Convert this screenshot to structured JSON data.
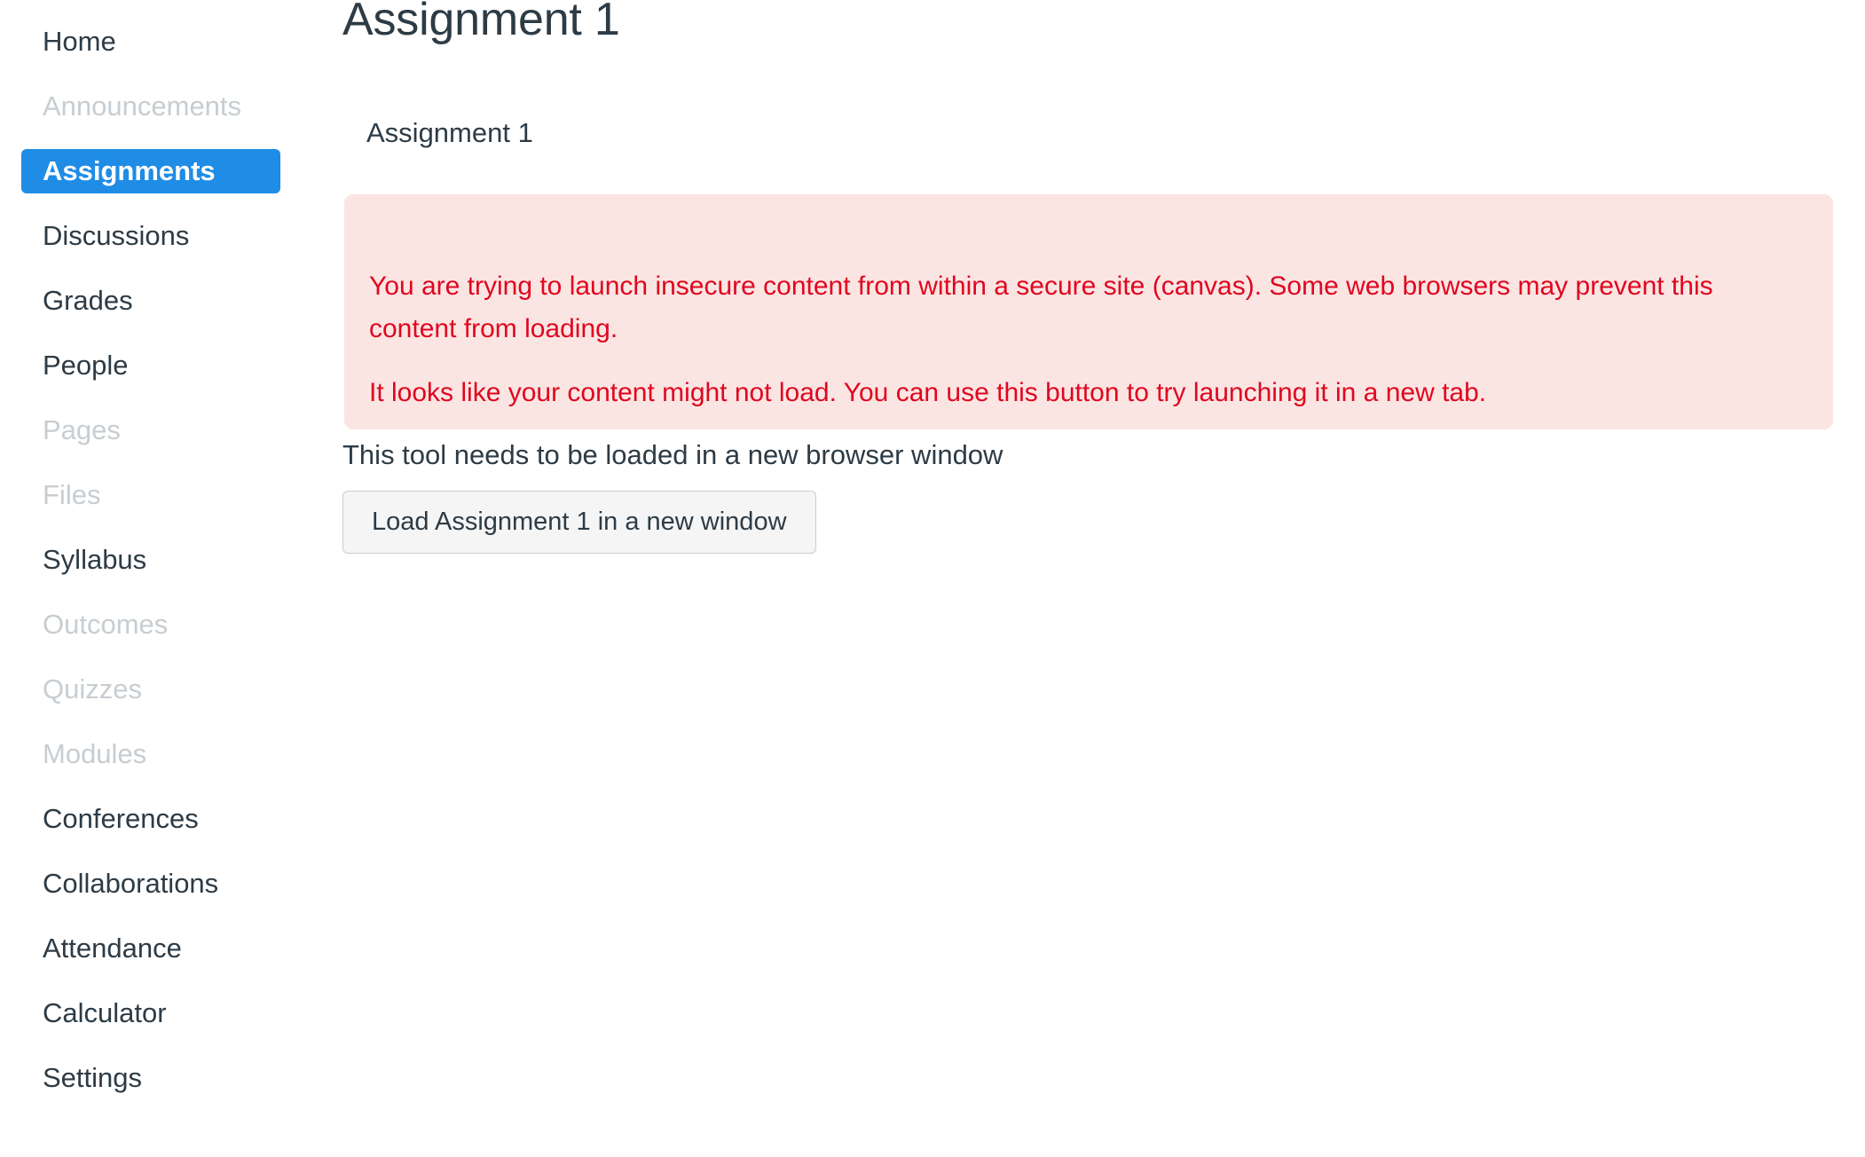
{
  "sidebar": {
    "items": [
      {
        "label": "Home",
        "state": "enabled"
      },
      {
        "label": "Announcements",
        "state": "disabled"
      },
      {
        "label": "Assignments",
        "state": "active"
      },
      {
        "label": "Discussions",
        "state": "enabled"
      },
      {
        "label": "Grades",
        "state": "enabled"
      },
      {
        "label": "People",
        "state": "enabled"
      },
      {
        "label": "Pages",
        "state": "disabled"
      },
      {
        "label": "Files",
        "state": "disabled"
      },
      {
        "label": "Syllabus",
        "state": "enabled"
      },
      {
        "label": "Outcomes",
        "state": "disabled"
      },
      {
        "label": "Quizzes",
        "state": "disabled"
      },
      {
        "label": "Modules",
        "state": "disabled"
      },
      {
        "label": "Conferences",
        "state": "enabled"
      },
      {
        "label": "Collaborations",
        "state": "enabled"
      },
      {
        "label": "Attendance",
        "state": "enabled"
      },
      {
        "label": "Calculator",
        "state": "enabled"
      },
      {
        "label": "Settings",
        "state": "enabled"
      }
    ]
  },
  "main": {
    "page_title": "Assignment 1",
    "tool_subtitle": "Assignment 1",
    "alert": {
      "paragraph_1": "You are trying to launch insecure content from within a secure site (canvas). Some web browsers may prevent this content from loading.",
      "paragraph_2": "It looks like your content might not load. You can use this button to try launching it in a new tab."
    },
    "load_hint": "This tool needs to be loaded in a new browser window",
    "load_button_label": "Load Assignment 1 in a new window"
  },
  "colors": {
    "active_nav_background": "#1f8ce5",
    "nav_text": "#2d3b45",
    "nav_text_disabled": "#c7cdd1",
    "alert_background": "#fbe5e3",
    "alert_text": "#e0061f",
    "button_background": "#f5f5f5",
    "button_border": "#c7cdd1"
  }
}
